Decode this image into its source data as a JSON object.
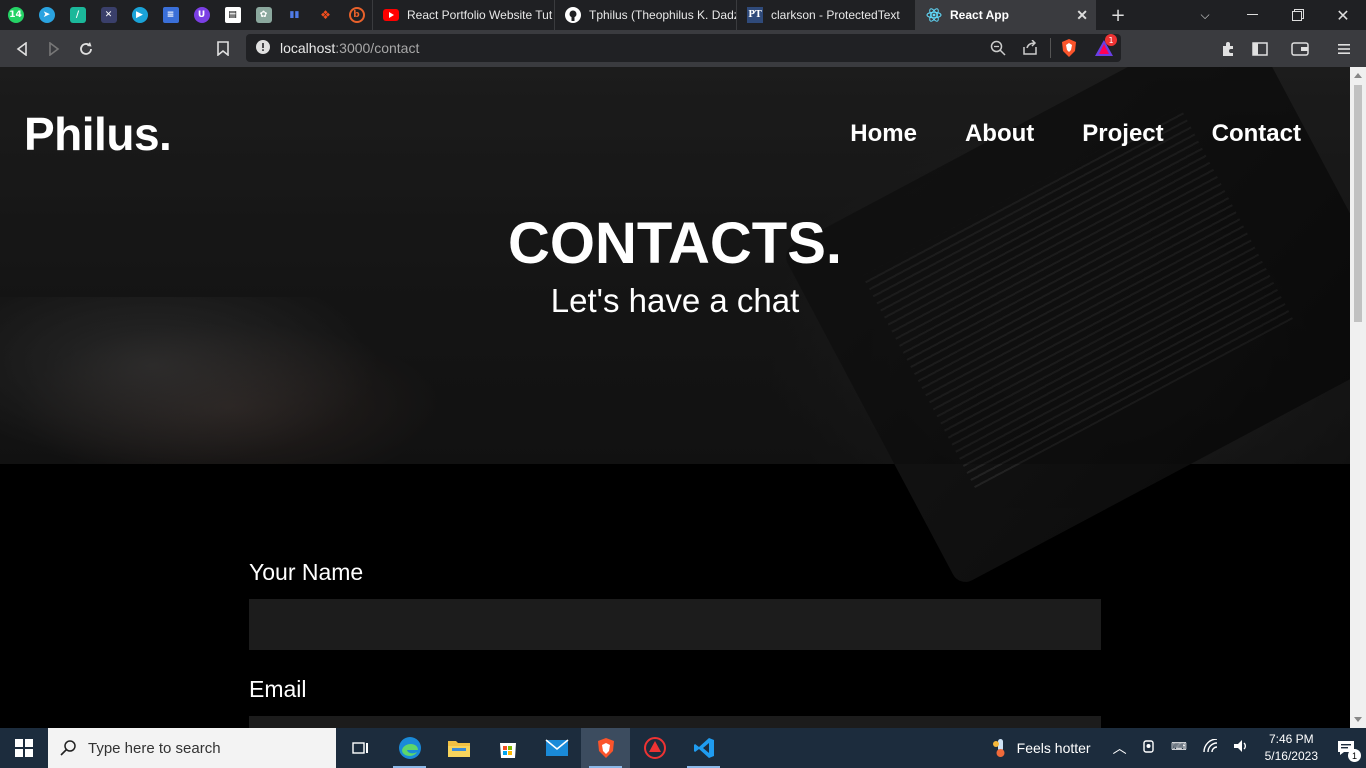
{
  "browser": {
    "pinned_tabs": [
      {
        "icon": "whatsapp-icon",
        "badge": "14",
        "color": "#25d366"
      },
      {
        "icon": "telegram-icon",
        "color": "#2aa3e0"
      },
      {
        "icon": "slack-app-icon",
        "color": "#1bb89a"
      },
      {
        "icon": "app-icon",
        "color": "#3a3f6a"
      },
      {
        "icon": "play-icon",
        "color": "#1aa3d8"
      },
      {
        "icon": "docs-icon",
        "color": "#3a6fd8"
      },
      {
        "icon": "shield-icon",
        "color": "#7b3fe4"
      },
      {
        "icon": "notion-icon",
        "color": "#ffffff"
      },
      {
        "icon": "chatgpt-icon",
        "color": "#8ba89e"
      },
      {
        "icon": "analytics-icon",
        "color": "#4f7be8"
      },
      {
        "icon": "figma-icon",
        "color": "#f24e1e"
      },
      {
        "icon": "behance-icon",
        "color": "#e8612b"
      }
    ],
    "tabs": [
      {
        "title": "React Portfolio Website Tut",
        "icon": "youtube-icon"
      },
      {
        "title": "Tphilus (Theophilus K. Dadz",
        "icon": "github-icon"
      },
      {
        "title": "clarkson - ProtectedText",
        "icon": "pt-icon",
        "icon_text": "PT"
      },
      {
        "title": "React App",
        "icon": "react-icon",
        "active": true
      }
    ],
    "new_tab": "+",
    "url_host": "localhost",
    "url_path": ":3000/contact",
    "alert_badge": "1"
  },
  "site": {
    "logo": "Philus.",
    "nav": [
      "Home",
      "About",
      "Project",
      "Contact"
    ],
    "hero_title": "CONTACTS.",
    "hero_subtitle": "Let's have a chat",
    "form": {
      "name_label": "Your Name",
      "email_label": "Email"
    }
  },
  "taskbar": {
    "search_placeholder": "Type here to search",
    "weather": "Feels hotter",
    "time": "7:46 PM",
    "date": "5/16/2023",
    "notification_count": "1"
  }
}
